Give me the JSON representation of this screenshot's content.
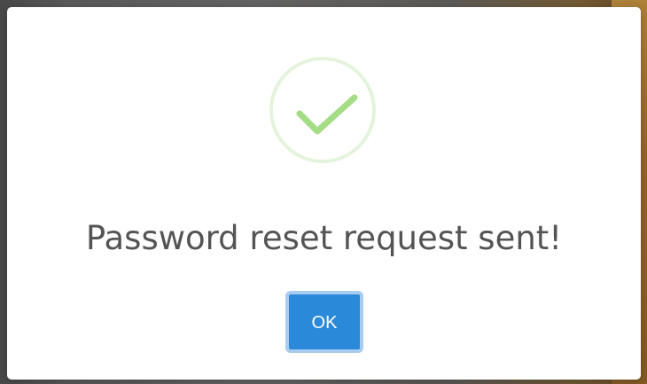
{
  "dialog": {
    "icon": "checkmark-icon",
    "title": "Password reset request sent!",
    "ok_label": "OK"
  },
  "colors": {
    "success_green": "#a5dc86",
    "success_ring": "#e5f3dc",
    "button_blue": "#2a89d8",
    "button_focus_ring": "#a7ccf0",
    "title_text": "#545454"
  }
}
